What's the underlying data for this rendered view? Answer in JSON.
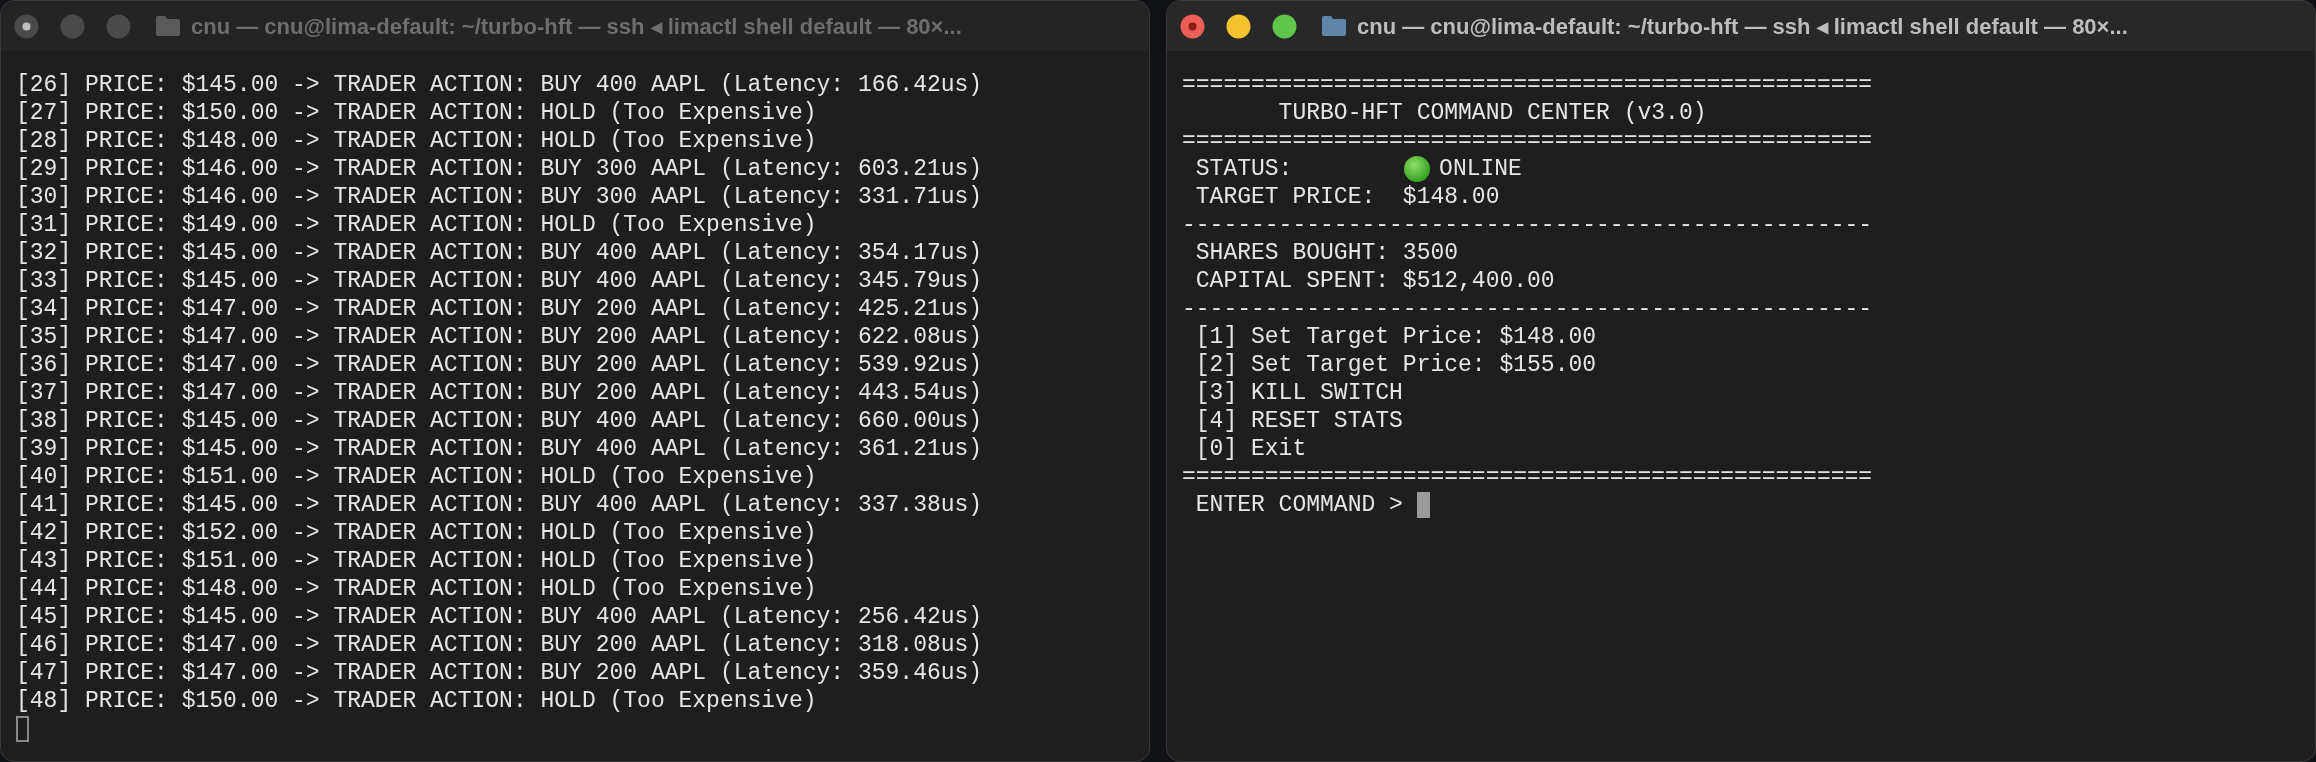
{
  "windows": [
    {
      "title": "cnu — cnu@lima-default: ~/turbo-hft — ssh ◂ limactl shell default — 80×...",
      "active": false,
      "lines": [
        {
          "kind": "text",
          "text": "[26] PRICE: $145.00 -> TRADER ACTION: BUY 400 AAPL (Latency: 166.42us)"
        },
        {
          "kind": "text",
          "text": "[27] PRICE: $150.00 -> TRADER ACTION: HOLD (Too Expensive)"
        },
        {
          "kind": "text",
          "text": "[28] PRICE: $148.00 -> TRADER ACTION: HOLD (Too Expensive)"
        },
        {
          "kind": "text",
          "text": "[29] PRICE: $146.00 -> TRADER ACTION: BUY 300 AAPL (Latency: 603.21us)"
        },
        {
          "kind": "text",
          "text": "[30] PRICE: $146.00 -> TRADER ACTION: BUY 300 AAPL (Latency: 331.71us)"
        },
        {
          "kind": "text",
          "text": "[31] PRICE: $149.00 -> TRADER ACTION: HOLD (Too Expensive)"
        },
        {
          "kind": "text",
          "text": "[32] PRICE: $145.00 -> TRADER ACTION: BUY 400 AAPL (Latency: 354.17us)"
        },
        {
          "kind": "text",
          "text": "[33] PRICE: $145.00 -> TRADER ACTION: BUY 400 AAPL (Latency: 345.79us)"
        },
        {
          "kind": "text",
          "text": "[34] PRICE: $147.00 -> TRADER ACTION: BUY 200 AAPL (Latency: 425.21us)"
        },
        {
          "kind": "text",
          "text": "[35] PRICE: $147.00 -> TRADER ACTION: BUY 200 AAPL (Latency: 622.08us)"
        },
        {
          "kind": "text",
          "text": "[36] PRICE: $147.00 -> TRADER ACTION: BUY 200 AAPL (Latency: 539.92us)"
        },
        {
          "kind": "text",
          "text": "[37] PRICE: $147.00 -> TRADER ACTION: BUY 200 AAPL (Latency: 443.54us)"
        },
        {
          "kind": "text",
          "text": "[38] PRICE: $145.00 -> TRADER ACTION: BUY 400 AAPL (Latency: 660.00us)"
        },
        {
          "kind": "text",
          "text": "[39] PRICE: $145.00 -> TRADER ACTION: BUY 400 AAPL (Latency: 361.21us)"
        },
        {
          "kind": "text",
          "text": "[40] PRICE: $151.00 -> TRADER ACTION: HOLD (Too Expensive)"
        },
        {
          "kind": "text",
          "text": "[41] PRICE: $145.00 -> TRADER ACTION: BUY 400 AAPL (Latency: 337.38us)"
        },
        {
          "kind": "text",
          "text": "[42] PRICE: $152.00 -> TRADER ACTION: HOLD (Too Expensive)"
        },
        {
          "kind": "text",
          "text": "[43] PRICE: $151.00 -> TRADER ACTION: HOLD (Too Expensive)"
        },
        {
          "kind": "text",
          "text": "[44] PRICE: $148.00 -> TRADER ACTION: HOLD (Too Expensive)"
        },
        {
          "kind": "text",
          "text": "[45] PRICE: $145.00 -> TRADER ACTION: BUY 400 AAPL (Latency: 256.42us)"
        },
        {
          "kind": "text",
          "text": "[46] PRICE: $147.00 -> TRADER ACTION: BUY 200 AAPL (Latency: 318.08us)"
        },
        {
          "kind": "text",
          "text": "[47] PRICE: $147.00 -> TRADER ACTION: BUY 200 AAPL (Latency: 359.46us)"
        },
        {
          "kind": "text",
          "text": "[48] PRICE: $150.00 -> TRADER ACTION: HOLD (Too Expensive)"
        },
        {
          "kind": "cursor"
        }
      ]
    },
    {
      "title": "cnu — cnu@lima-default: ~/turbo-hft — ssh ◂ limactl shell default — 80×...",
      "active": true,
      "lines": [
        {
          "kind": "text",
          "text": "=================================================="
        },
        {
          "kind": "text",
          "text": "       TURBO-HFT COMMAND CENTER (v3.0)"
        },
        {
          "kind": "text",
          "text": "=================================================="
        },
        {
          "kind": "status",
          "label": " STATUS:",
          "value": "ONLINE"
        },
        {
          "kind": "text",
          "text": " TARGET PRICE:  $148.00"
        },
        {
          "kind": "text",
          "text": "--------------------------------------------------"
        },
        {
          "kind": "text",
          "text": " SHARES BOUGHT: 3500"
        },
        {
          "kind": "text",
          "text": " CAPITAL SPENT: $512,400.00"
        },
        {
          "kind": "text",
          "text": "--------------------------------------------------"
        },
        {
          "kind": "text",
          "text": " [1] Set Target Price: $148.00"
        },
        {
          "kind": "text",
          "text": " [2] Set Target Price: $155.00"
        },
        {
          "kind": "text",
          "text": " [3] KILL SWITCH"
        },
        {
          "kind": "text",
          "text": " [4] RESET STATS"
        },
        {
          "kind": "text",
          "text": " [0] Exit"
        },
        {
          "kind": "text",
          "text": "=================================================="
        },
        {
          "kind": "prompt",
          "text": " ENTER COMMAND > "
        }
      ]
    }
  ]
}
